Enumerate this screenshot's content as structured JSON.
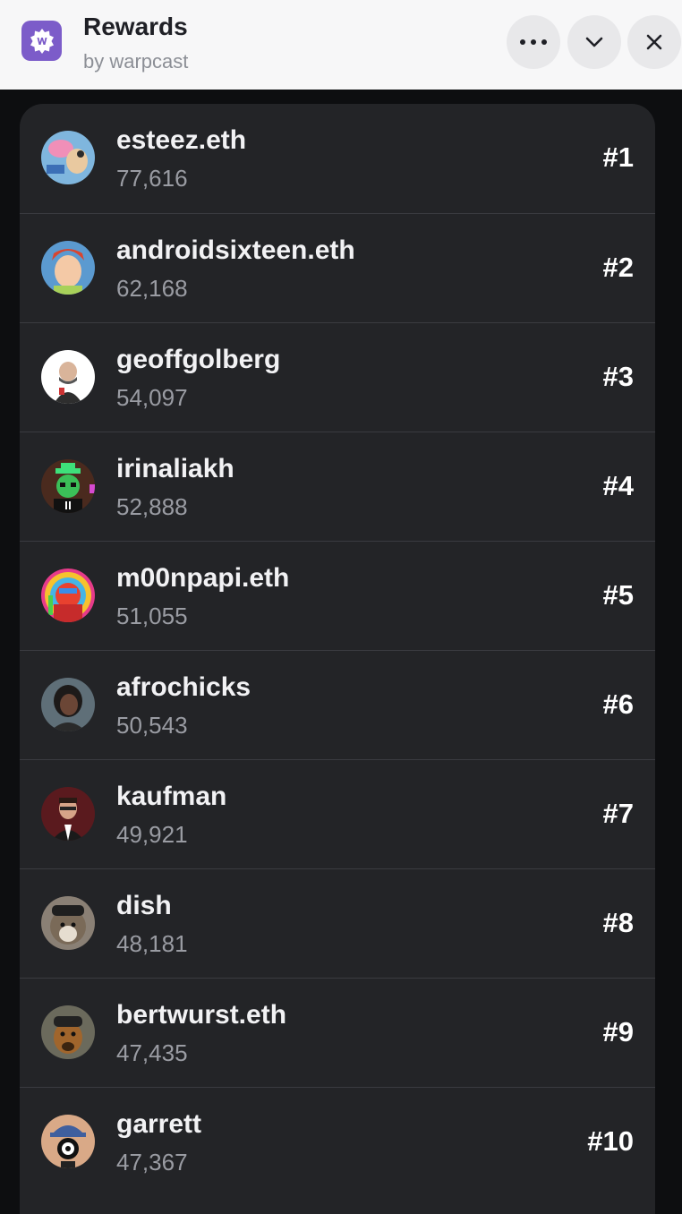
{
  "header": {
    "title": "Rewards",
    "subtitle": "by warpcast",
    "app_icon": "warpcast-badge-icon",
    "buttons": [
      "more-icon",
      "chevron-down-icon",
      "close-icon"
    ]
  },
  "leaderboard": [
    {
      "username": "esteez.eth",
      "score": "77,616",
      "rank": "#1"
    },
    {
      "username": "androidsixteen.eth",
      "score": "62,168",
      "rank": "#2"
    },
    {
      "username": "geoffgolberg",
      "score": "54,097",
      "rank": "#3"
    },
    {
      "username": "irinaliakh",
      "score": "52,888",
      "rank": "#4"
    },
    {
      "username": "m00npapi.eth",
      "score": "51,055",
      "rank": "#5"
    },
    {
      "username": "afrochicks",
      "score": "50,543",
      "rank": "#6"
    },
    {
      "username": "kaufman",
      "score": "49,921",
      "rank": "#7"
    },
    {
      "username": "dish",
      "score": "48,181",
      "rank": "#8"
    },
    {
      "username": "bertwurst.eth",
      "score": "47,435",
      "rank": "#9"
    },
    {
      "username": "garrett",
      "score": "47,367",
      "rank": "#10"
    }
  ],
  "colors": {
    "brand": "#7c5cc9",
    "header_bg": "#f7f7f8",
    "list_bg": "#232427",
    "page_bg": "#0d0e10"
  }
}
